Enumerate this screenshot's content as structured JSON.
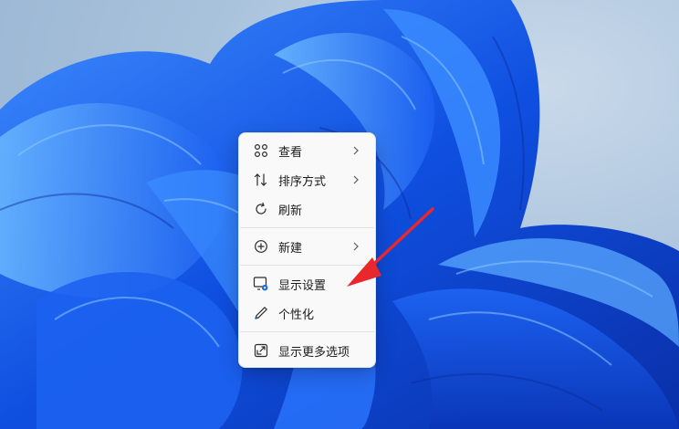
{
  "desktop": {
    "wallpaper": "windows-11-bloom",
    "wallpaper_colors": [
      "#0b3fd0",
      "#1f6cf0",
      "#5ab0ff"
    ]
  },
  "context_menu": {
    "items": [
      {
        "label": "查看",
        "icon": "grid-view-icon",
        "has_submenu": true
      },
      {
        "label": "排序方式",
        "icon": "sort-icon",
        "has_submenu": true
      },
      {
        "label": "刷新",
        "icon": "refresh-icon",
        "has_submenu": false
      },
      {
        "label": "新建",
        "icon": "new-plus-icon",
        "has_submenu": true
      },
      {
        "label": "显示设置",
        "icon": "display-settings-icon",
        "has_submenu": false
      },
      {
        "label": "个性化",
        "icon": "personalize-pen-icon",
        "has_submenu": false
      },
      {
        "label": "显示更多选项",
        "icon": "show-more-options-icon",
        "has_submenu": false
      }
    ]
  },
  "annotation": {
    "type": "arrow",
    "color": "#e8282a",
    "points_to": "显示设置"
  }
}
